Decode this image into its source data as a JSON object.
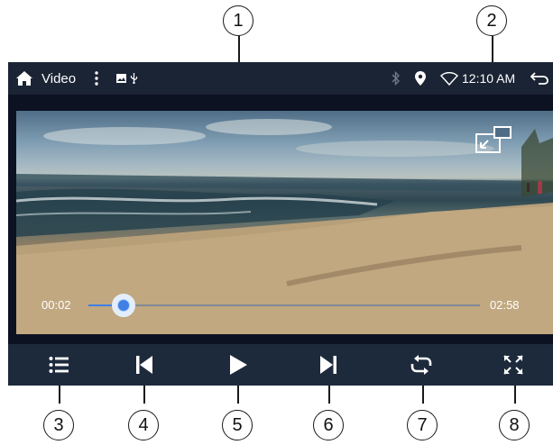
{
  "status_bar": {
    "app_title": "Video",
    "clock": "12:10 AM",
    "icons": [
      "home-icon",
      "more-vert-icon",
      "image-icon",
      "usb-icon",
      "bluetooth-icon",
      "location-icon",
      "wifi-icon",
      "back-icon"
    ]
  },
  "player": {
    "elapsed": "00:02",
    "total": "02:58",
    "progress_fraction": 0.012,
    "pip_icon": "picture-in-picture-icon"
  },
  "controls": [
    "playlist-icon",
    "previous-icon",
    "play-icon",
    "next-icon",
    "repeat-icon",
    "fullscreen-icon"
  ],
  "callouts": {
    "c1": "1",
    "c2": "2",
    "c3": "3",
    "c4": "4",
    "c5": "5",
    "c6": "6",
    "c7": "7",
    "c8": "8"
  },
  "colors": {
    "status_bar": "#1b2434",
    "control_bar": "#1d2a3c",
    "accent": "#3f7fe6"
  }
}
